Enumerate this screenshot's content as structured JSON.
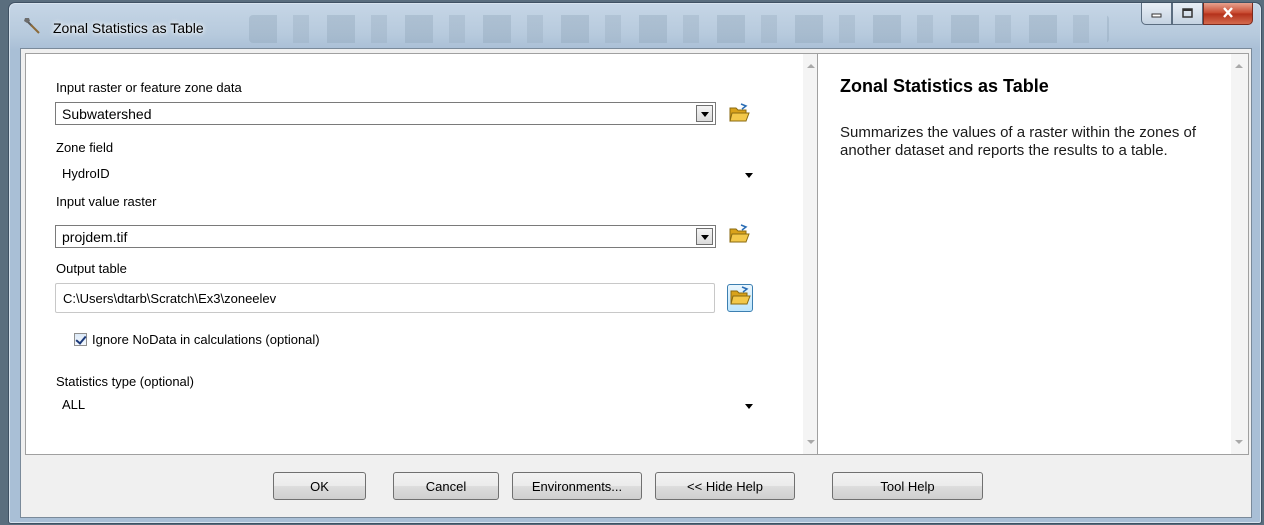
{
  "window": {
    "title": "Zonal Statistics as Table"
  },
  "form": {
    "input_zone": {
      "label": "Input raster or feature zone data",
      "value": "Subwatershed"
    },
    "zone_field": {
      "label": "Zone field",
      "value": "HydroID"
    },
    "input_value": {
      "label": "Input value raster",
      "value": "projdem.tif"
    },
    "output_table": {
      "label": "Output table",
      "value": "C:\\Users\\dtarb\\Scratch\\Ex3\\zoneelev"
    },
    "ignore_nodata": {
      "label": "Ignore NoData in calculations (optional)",
      "checked": true
    },
    "stat_type": {
      "label": "Statistics type (optional)",
      "value": "ALL"
    }
  },
  "help": {
    "title": "Zonal Statistics as Table",
    "body": "Summarizes the values of a raster within the zones of another dataset and reports the results to a table."
  },
  "buttons": {
    "ok": "OK",
    "cancel": "Cancel",
    "environments": "Environments...",
    "hide_help": "<< Hide Help",
    "tool_help": "Tool Help"
  },
  "icons": {
    "title": "hammer-icon",
    "folder": "open-folder-icon",
    "minimize": "minimize-icon",
    "maximize": "maximize-icon",
    "close": "close-icon"
  },
  "colors": {
    "folder": "#e8b320",
    "accent": "#3c7fb1",
    "close": "#c7452b"
  }
}
